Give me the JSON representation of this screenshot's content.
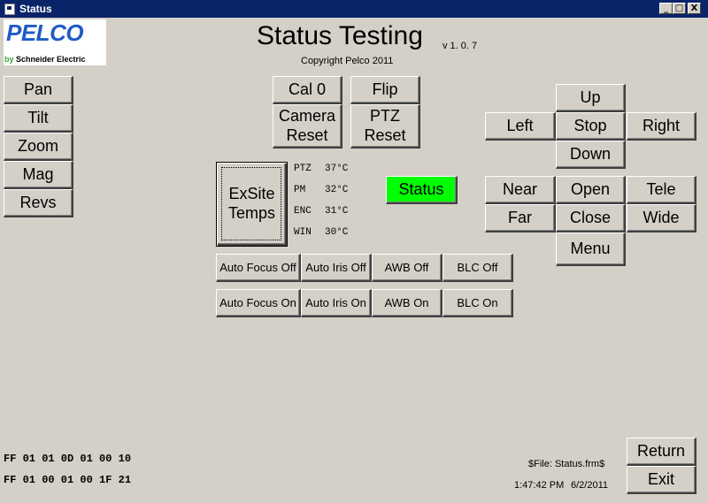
{
  "window": {
    "title": "Status",
    "controls": {
      "minimize": "_",
      "maximize": "□",
      "close": "X"
    }
  },
  "logo": {
    "brand": "PELCO",
    "by": "by",
    "company": "Schneider Electric"
  },
  "header": {
    "title": "Status Testing",
    "version": "v 1. 0. 7",
    "copyright": "Copyright Pelco 2011"
  },
  "left_buttons": [
    "Pan",
    "Tilt",
    "Zoom",
    "Mag",
    "Revs"
  ],
  "center_buttons": {
    "cal0": "Cal 0",
    "flip": "Flip",
    "camera_reset": "Camera Reset",
    "ptz_reset": "PTZ Reset",
    "exsite_temps": "ExSite Temps",
    "status": "Status"
  },
  "temps": [
    {
      "label": "PTZ",
      "value": "37°C"
    },
    {
      "label": "PM",
      "value": "32°C"
    },
    {
      "label": "ENC",
      "value": "31°C"
    },
    {
      "label": "WIN",
      "value": "30°C"
    }
  ],
  "auto_off": [
    "Auto Focus Off",
    "Auto Iris Off",
    "AWB Off",
    "BLC Off"
  ],
  "auto_on": [
    "Auto Focus On",
    "Auto Iris On",
    "AWB On",
    "BLC On"
  ],
  "ptz": {
    "up": "Up",
    "left": "Left",
    "stop": "Stop",
    "right": "Right",
    "down": "Down"
  },
  "lens": {
    "near": "Near",
    "open": "Open",
    "tele": "Tele",
    "far": "Far",
    "close": "Close",
    "wide": "Wide",
    "menu": "Menu"
  },
  "footer": {
    "hex_line1": "FF  01  01  0D  01  00  10",
    "hex_line2": "FF  01  00  01  00  1F  21",
    "file": "$File: Status.frm$",
    "time": "1:47:42 PM",
    "date": "6/2/2011",
    "return_label": "Return",
    "exit_label": "Exit"
  },
  "colors": {
    "title_bar": "#0a246a",
    "status_button": "#00ff00",
    "window_face": "#d4d0c8"
  }
}
